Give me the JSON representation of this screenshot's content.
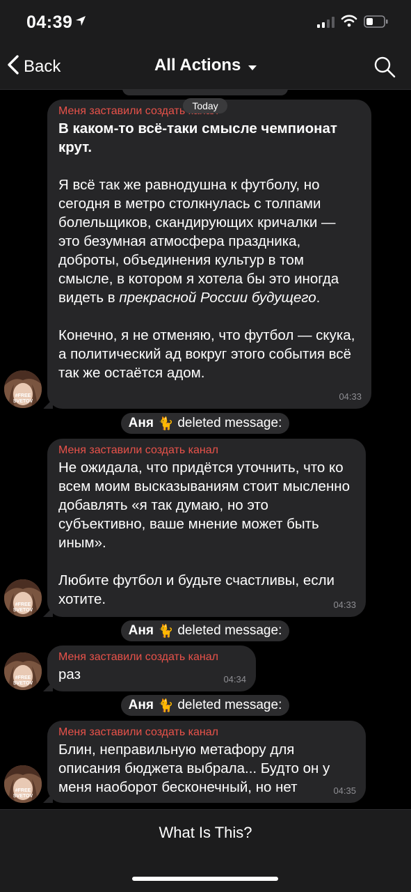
{
  "status_bar": {
    "time": "04:39"
  },
  "nav": {
    "back_label": "Back",
    "title": "All Actions"
  },
  "chat": {
    "date_badge": "Today",
    "deleted_notice": {
      "user": "Аня",
      "emoji": "🐈",
      "text": "deleted message:"
    },
    "avatar_text": "#FREE\nSVETOV",
    "messages": [
      {
        "sender": "Меня заставили создать канал",
        "bold": "В каком-то всё-таки смысле чемпионат крут.",
        "text_1": "Я всё так же равнодушна к футболу, но сегодня в метро столкнулась с толпами болельщиков, скандирующих кричалки — это безумная атмосфера праздника, доброты, объединения культур в том смысле, в котором я хотела бы это иногда видеть в ",
        "italic": "прекрасной России будущего",
        "text_2": ".\n\nКонечно, я не отменяю, что футбол — скука, а политический ад вокруг этого события всё так же остаётся адом.",
        "time": "04:33"
      },
      {
        "sender": "Меня заставили создать канал",
        "text": "Не ожидала, что придётся уточнить, что ко всем моим высказываниям стоит мысленно добавлять «я так думаю, но это субъективно, ваше мнение может быть иным».\n\nЛюбите футбол и будьте счастливы, если хотите.",
        "time": "04:33"
      },
      {
        "sender": "Меня заставили создать канал",
        "text": "раз",
        "time": "04:34"
      },
      {
        "sender": "Меня заставили создать канал",
        "text": "Блин, неправильную метафору для описания бюджета выбрала... Будто он у меня наоборот бесконечный, но нет",
        "time": "04:35"
      }
    ]
  },
  "bottom_bar": {
    "action_label": "What Is This?"
  },
  "colors": {
    "background": "#000000",
    "bubble": "#262628",
    "sender": "#e8524a",
    "bar": "#1c1c1d"
  }
}
